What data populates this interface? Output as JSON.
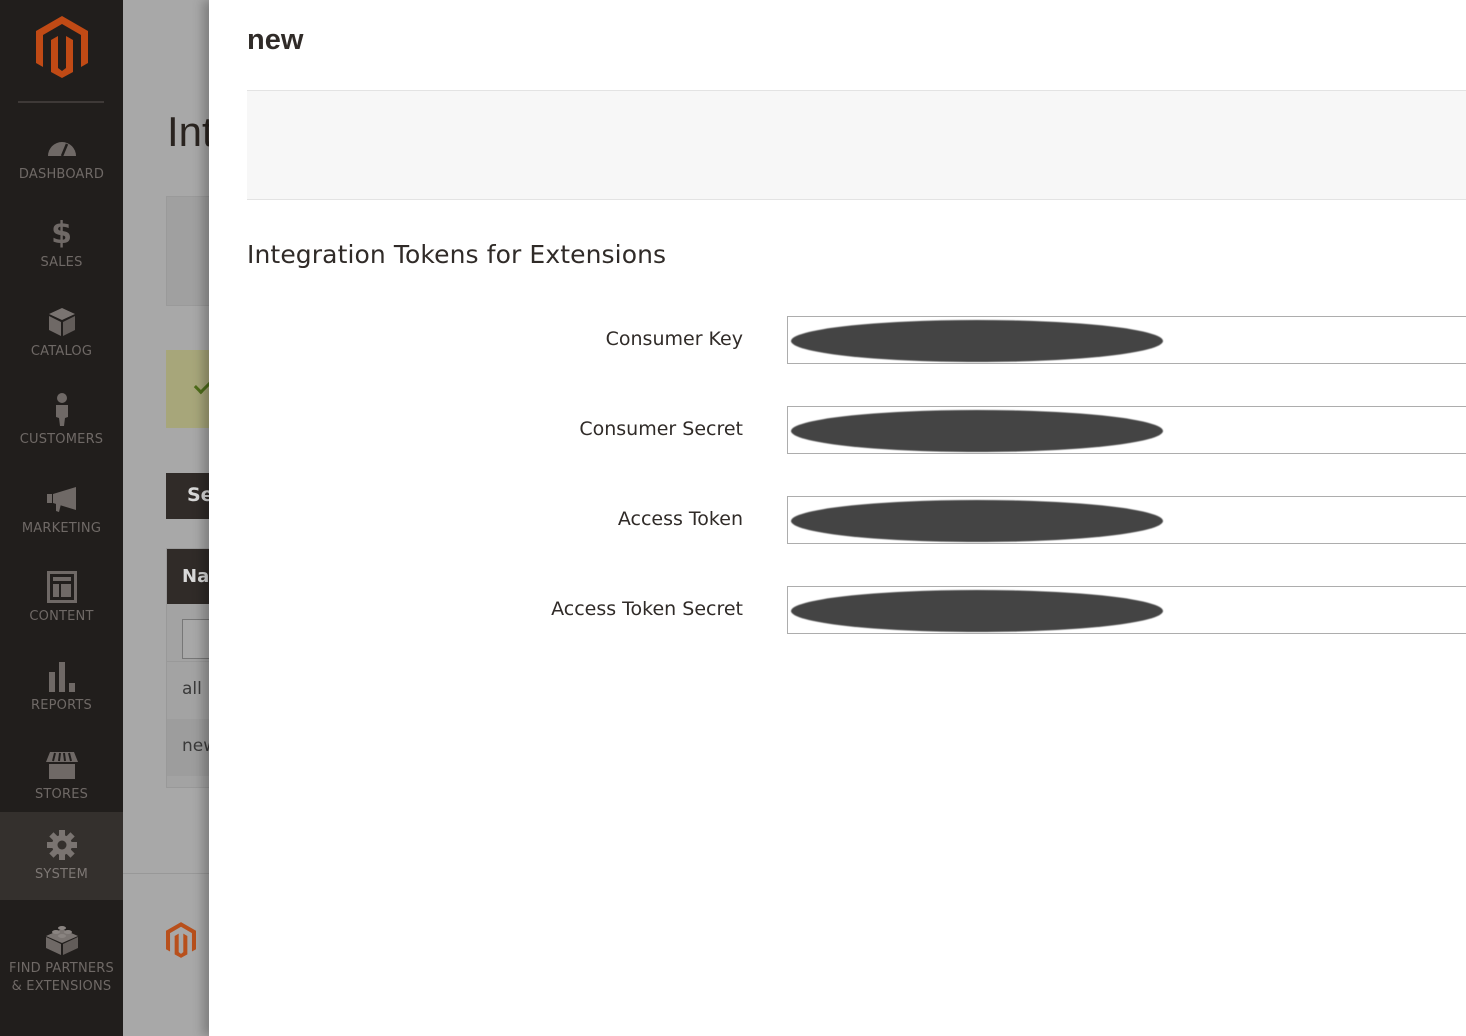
{
  "sidebar": {
    "logo": "magento-logo",
    "items": [
      {
        "label": "DASHBOARD",
        "icon": "dashboard-gauge-icon",
        "active": false
      },
      {
        "label": "SALES",
        "icon": "dollar-icon",
        "active": false
      },
      {
        "label": "CATALOG",
        "icon": "box-icon",
        "active": false
      },
      {
        "label": "CUSTOMERS",
        "icon": "person-icon",
        "active": false
      },
      {
        "label": "MARKETING",
        "icon": "megaphone-icon",
        "active": false
      },
      {
        "label": "CONTENT",
        "icon": "layout-icon",
        "active": false
      },
      {
        "label": "REPORTS",
        "icon": "bar-chart-icon",
        "active": false
      },
      {
        "label": "STORES",
        "icon": "storefront-icon",
        "active": false
      },
      {
        "label": "SYSTEM",
        "icon": "gear-icon",
        "active": true
      },
      {
        "label_line1": "FIND PARTNERS",
        "label_line2": "& EXTENSIONS",
        "icon": "lego-brick-icon",
        "active": false
      }
    ]
  },
  "background_page": {
    "title_partial": "Int",
    "search_button_partial": "Se",
    "grid_header_partial": "Na",
    "rows_partial": [
      "all",
      "new"
    ]
  },
  "modal": {
    "title": "new",
    "section_title": "Integration Tokens for Extensions",
    "fields": [
      {
        "label": "Consumer Key",
        "value_state": "redacted"
      },
      {
        "label": "Consumer Secret",
        "value_state": "redacted"
      },
      {
        "label": "Access Token",
        "value_state": "redacted"
      },
      {
        "label": "Access Token Secret",
        "value_state": "redacted"
      }
    ]
  },
  "colors": {
    "brand_orange": "#eb5202",
    "sidebar_bg": "#211e1c",
    "text_dark": "#302b28"
  }
}
